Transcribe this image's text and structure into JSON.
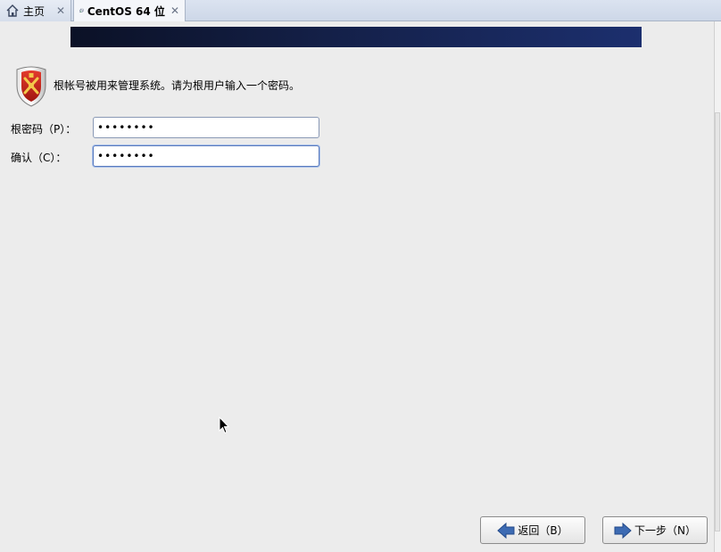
{
  "tabs": [
    {
      "label": "主页",
      "icon": "home-icon",
      "close": "✕"
    },
    {
      "label": "CentOS 64 位",
      "icon": "vm-icon",
      "close": "✕"
    }
  ],
  "installer": {
    "info_text": "根帐号被用来管理系统。请为根用户输入一个密码。",
    "root_password_label": "根密码（P）：",
    "root_password_value": "••••••••",
    "confirm_label": "确认（C）：",
    "confirm_value": "••••••••"
  },
  "buttons": {
    "back_label": "返回（B）",
    "next_label": "下一步（N）"
  },
  "colors": {
    "background": "#ececec",
    "banner_start": "#0b1126",
    "banner_end": "#1c2f6e",
    "arrow_blue": "#3d6bb3"
  }
}
